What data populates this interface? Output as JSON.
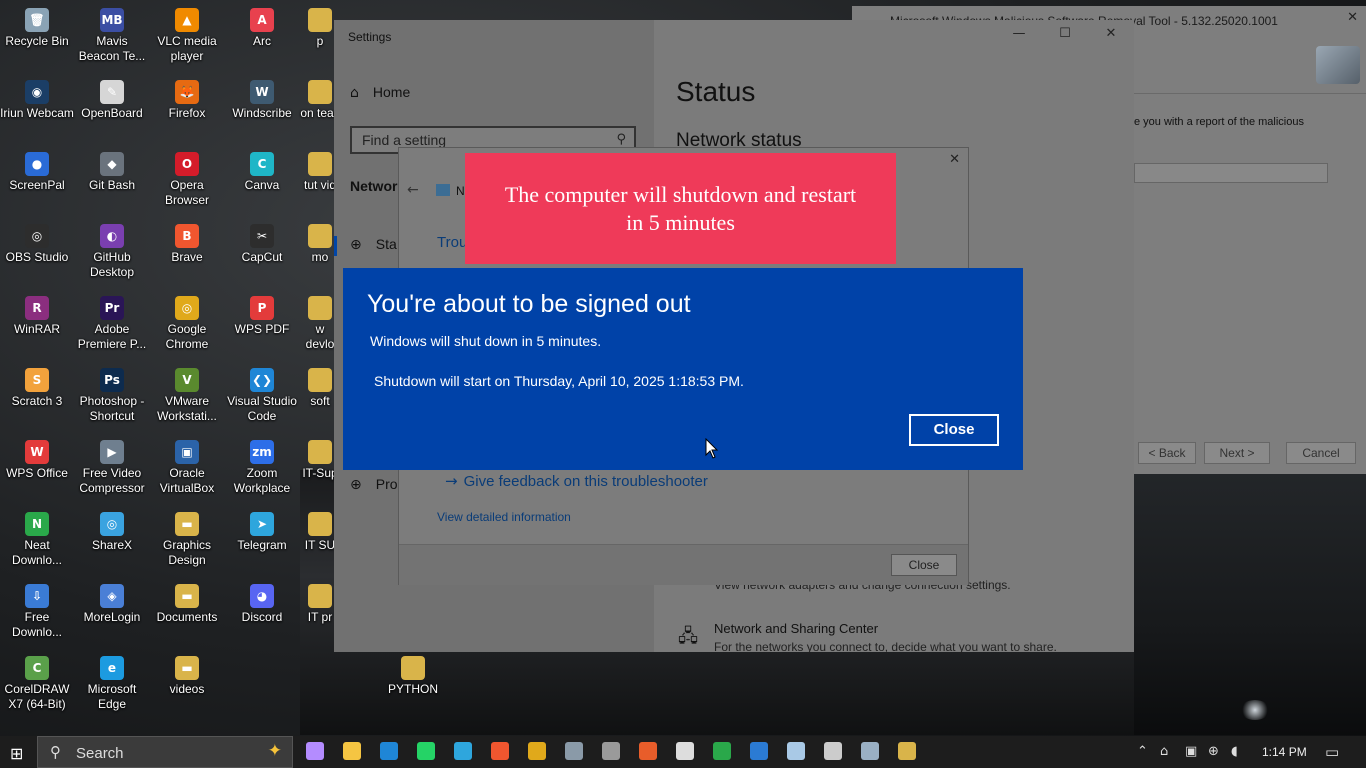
{
  "desktop_icons": [
    {
      "label": "Recycle Bin",
      "glyph": "🗑",
      "color": "#8aa3b5"
    },
    {
      "label": "Mavis Beacon Te...",
      "glyph": "MB",
      "color": "#3b4ea3"
    },
    {
      "label": "VLC media player",
      "glyph": "▲",
      "color": "#f08a00"
    },
    {
      "label": "Arc",
      "glyph": "A",
      "color": "#e8414e"
    },
    {
      "label": "Iriun Webcam",
      "glyph": "◉",
      "color": "#1b3e66"
    },
    {
      "label": "OpenBoard",
      "glyph": "✎",
      "color": "#d6d6d6"
    },
    {
      "label": "Firefox",
      "glyph": "🦊",
      "color": "#e66a12"
    },
    {
      "label": "Windscribe",
      "glyph": "W",
      "color": "#3e5a71"
    },
    {
      "label": "ScreenPal",
      "glyph": "●",
      "color": "#2a6bd6"
    },
    {
      "label": "Git Bash",
      "glyph": "◆",
      "color": "#6a737d"
    },
    {
      "label": "Opera Browser",
      "glyph": "O",
      "color": "#d41c2a"
    },
    {
      "label": "Canva",
      "glyph": "C",
      "color": "#1fb6c7"
    },
    {
      "label": "OBS Studio",
      "glyph": "◎",
      "color": "#2d2d2d"
    },
    {
      "label": "GitHub Desktop",
      "glyph": "◐",
      "color": "#7a3fb0"
    },
    {
      "label": "Brave",
      "glyph": "B",
      "color": "#f0562f"
    },
    {
      "label": "CapCut",
      "glyph": "✂",
      "color": "#2d2d2d"
    },
    {
      "label": "WinRAR",
      "glyph": "R",
      "color": "#8b2e7f"
    },
    {
      "label": "Adobe Premiere P...",
      "glyph": "Pr",
      "color": "#2a1556"
    },
    {
      "label": "Google Chrome",
      "glyph": "◎",
      "color": "#e0a91b"
    },
    {
      "label": "WPS PDF",
      "glyph": "P",
      "color": "#e33b3b"
    },
    {
      "label": "Scratch 3",
      "glyph": "S",
      "color": "#f2a23c"
    },
    {
      "label": "Photoshop - Shortcut",
      "glyph": "Ps",
      "color": "#0d2b4e"
    },
    {
      "label": "VMware Workstati...",
      "glyph": "V",
      "color": "#5a8a2e"
    },
    {
      "label": "Visual Studio Code",
      "glyph": "❮❯",
      "color": "#1f86d6"
    },
    {
      "label": "WPS Office",
      "glyph": "W",
      "color": "#e33b3b"
    },
    {
      "label": "Free Video Compressor",
      "glyph": "▶",
      "color": "#6f7f8f"
    },
    {
      "label": "Oracle VirtualBox",
      "glyph": "▣",
      "color": "#2b63a8"
    },
    {
      "label": "Zoom Workplace",
      "glyph": "zm",
      "color": "#2d6ee8"
    },
    {
      "label": "Neat Downlo...",
      "glyph": "N",
      "color": "#2aa84a"
    },
    {
      "label": "ShareX",
      "glyph": "◎",
      "color": "#3aa3e0"
    },
    {
      "label": "Graphics Design",
      "glyph": "▬",
      "color": "#d9b44a"
    },
    {
      "label": "Telegram",
      "glyph": "➤",
      "color": "#2ea6dd"
    },
    {
      "label": "Free Downlo...",
      "glyph": "⇩",
      "color": "#3a7bd5"
    },
    {
      "label": "MoreLogin",
      "glyph": "◈",
      "color": "#4a7fd6"
    },
    {
      "label": "Documents",
      "glyph": "▬",
      "color": "#d9b44a"
    },
    {
      "label": "Discord",
      "glyph": "◕",
      "color": "#5865f2"
    },
    {
      "label": "CorelDRAW X7 (64-Bit)",
      "glyph": "C",
      "color": "#5aa04a"
    },
    {
      "label": "Microsoft Edge",
      "glyph": "e",
      "color": "#1c9be0"
    },
    {
      "label": "videos",
      "glyph": "▬",
      "color": "#d9b44a"
    }
  ],
  "partial_icons": [
    {
      "label": "p",
      "top": "—"
    },
    {
      "label": "on teac"
    },
    {
      "label": "tut vid"
    },
    {
      "label": "mo"
    },
    {
      "label": "w devlo"
    },
    {
      "label": "soft"
    },
    {
      "label": "IT-Sup"
    },
    {
      "label": "IT SU"
    },
    {
      "label": "IT pr"
    },
    {
      "label": "PYTHON"
    }
  ],
  "settings": {
    "title": "Settings",
    "home": "Home",
    "search_placeholder": "Find a setting",
    "section": "Networ",
    "nav_status": "Sta",
    "nav_proxy": "Pro",
    "page_title": "Status",
    "network_status": "Network status",
    "adapter_text": "View network adapters and change connection settings.",
    "nsc_title": "Network and Sharing Center",
    "nsc_desc": "For the networks you connect to, decide what you want to share."
  },
  "msrt": {
    "title": "Microsoft Windows Malicious Software Removal Tool - 5.132.25020.1001",
    "body_text": "e you with a report of the malicious",
    "back": "< Back",
    "next": "Next >",
    "cancel": "Cancel"
  },
  "troubleshooter": {
    "header_text": "N",
    "trou_text": "Trou",
    "feedback": "Give feedback on this troubleshooter",
    "details": "View detailed information",
    "close": "Close"
  },
  "red_notification": {
    "text": "The computer will shutdown and restart in 5 minutes",
    "color": "#ef3a59"
  },
  "signout": {
    "heading": "You're about to be signed out",
    "line1": "Windows will shut down in 5 minutes.",
    "line2": "Shutdown will start on Thursday, April 10, 2025 1:18:53 PM.",
    "close": "Close",
    "color": "#0042a8"
  },
  "taskbar": {
    "search": "Search",
    "time": "1:14 PM",
    "apps": [
      {
        "name": "copilot-app",
        "color": "#b48cff"
      },
      {
        "name": "file-explorer-app",
        "color": "#f5c542"
      },
      {
        "name": "vscode-app",
        "color": "#1f86d6"
      },
      {
        "name": "whatsapp-app",
        "color": "#25d366"
      },
      {
        "name": "telegram-app",
        "color": "#2ea6dd"
      },
      {
        "name": "brave-app",
        "color": "#f0562f"
      },
      {
        "name": "chrome-app",
        "color": "#e0a91b"
      },
      {
        "name": "wordpress-app",
        "color": "#8a9aa8"
      },
      {
        "name": "obs-app",
        "color": "#9a9a9a"
      },
      {
        "name": "edge-app",
        "color": "#e85d2a"
      },
      {
        "name": "qq-app",
        "color": "#dddddd"
      },
      {
        "name": "excel-app",
        "color": "#2aa84a"
      },
      {
        "name": "outlook-app",
        "color": "#2b7bd4"
      },
      {
        "name": "paint-app",
        "color": "#a9c9e6"
      },
      {
        "name": "settings-app",
        "color": "#cccccc"
      },
      {
        "name": "msrt-app",
        "color": "#9ab0c4"
      },
      {
        "name": "tools-app",
        "color": "#d9b44a"
      }
    ]
  }
}
